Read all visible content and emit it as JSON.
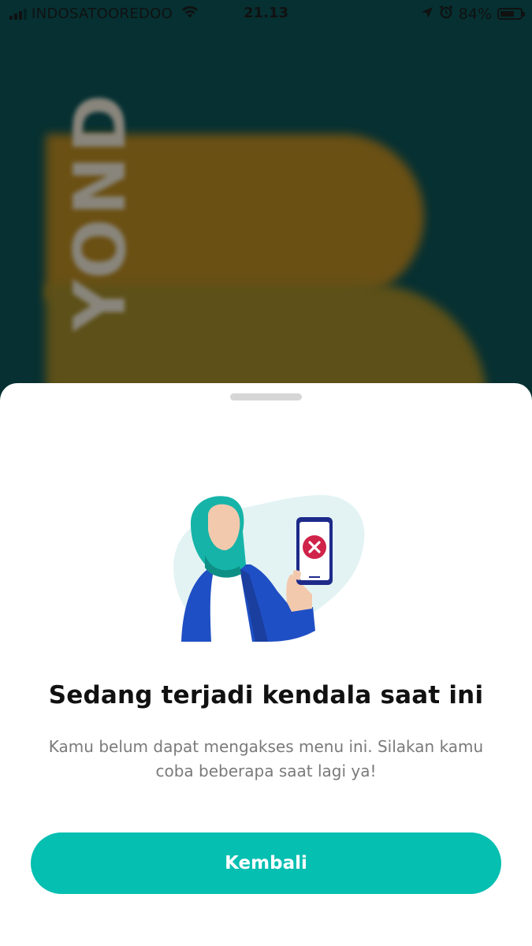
{
  "status_bar": {
    "carrier": "INDOSATOOREDOO",
    "time": "21.13",
    "battery_percent": "84%",
    "battery_level": 0.84,
    "signal_bars_active": 3,
    "signal_bars_total": 4,
    "icons": [
      "signal-icon",
      "wifi-icon",
      "location-icon",
      "alarm-icon",
      "battery-icon"
    ]
  },
  "background": {
    "brand_text": "YOND"
  },
  "sheet": {
    "title": "Sedang terjadi kendala saat ini",
    "message": "Kamu belum dapat mengakses menu ini. Silakan kamu coba beberapa saat lagi ya!",
    "button_label": "Kembali",
    "illustration": "person-with-phone-error-illustration"
  },
  "colors": {
    "accent": "#05bfb1",
    "error": "#d0234a",
    "phone_frame": "#1d2a8a",
    "jacket": "#1f4fc4",
    "hijab": "#16b4a8"
  }
}
